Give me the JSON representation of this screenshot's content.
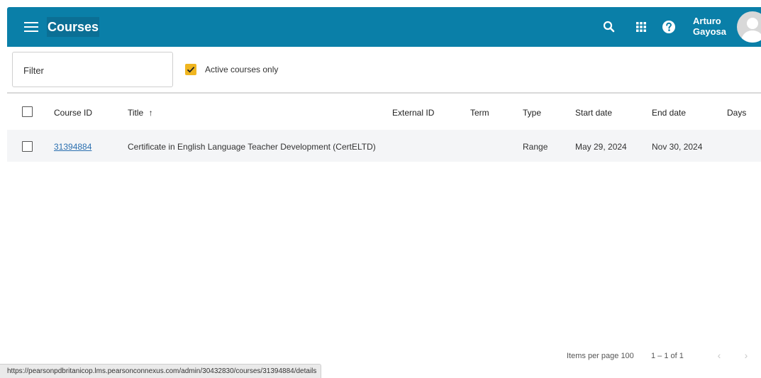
{
  "app_bar": {
    "title": "Courses",
    "menu_icon": "hamburger-menu-icon",
    "icons": [
      "search-icon",
      "apps-grid-icon",
      "help-icon"
    ],
    "user": {
      "first_name": "Arturo",
      "last_name": "Gayosa"
    },
    "background_color": "#0a7fa8"
  },
  "filters": {
    "filter_placeholder": "Filter",
    "filter_value": "",
    "active_only_label": "Active courses only",
    "active_only_checked": true,
    "checkbox_color": "#f0b620"
  },
  "table": {
    "headers": {
      "course_id": "Course ID",
      "title": "Title",
      "sort_indicator": "↑",
      "external_id": "External ID",
      "term": "Term",
      "type": "Type",
      "start_date": "Start date",
      "end_date": "End date",
      "days": "Days"
    },
    "rows": [
      {
        "course_id": "31394884",
        "title": "Certificate in English Language Teacher Development (CertELTD)",
        "external_id": "",
        "term": "",
        "type": "Range",
        "start_date": "May 29, 2024",
        "end_date": "Nov 30, 2024",
        "days": ""
      }
    ]
  },
  "pagination": {
    "items_per_page_label": "Items per page",
    "items_per_page": "100",
    "range_label": "1 – 1 of 1"
  },
  "status_bar": {
    "url": "https://pearsonpdbritanicop.lms.pearsonconnexus.com/admin/30432830/courses/31394884/details"
  }
}
